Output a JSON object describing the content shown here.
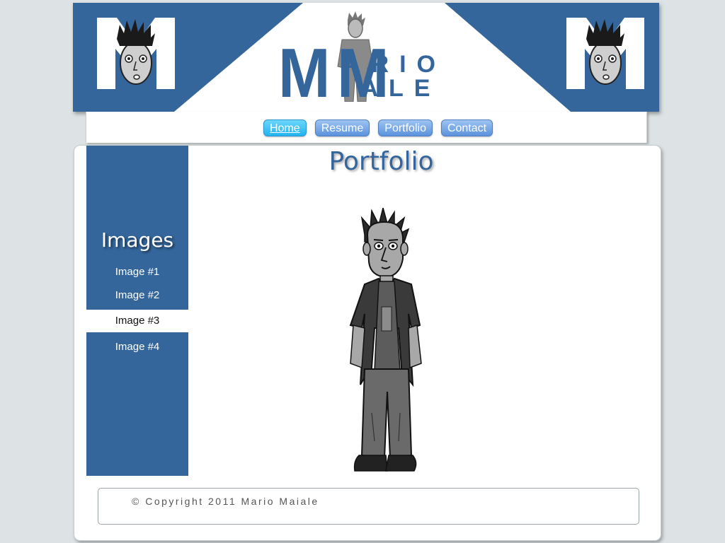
{
  "header": {
    "logo_first": "ARIO",
    "logo_last": "IALE",
    "logo_initial": "M",
    "logo_initial_2": "M"
  },
  "nav": {
    "items": [
      {
        "label": "Home",
        "active": true
      },
      {
        "label": "Resume",
        "active": false
      },
      {
        "label": "Portfolio",
        "active": false
      },
      {
        "label": "Contact",
        "active": false
      }
    ]
  },
  "sidebar": {
    "title": "Images",
    "items": [
      {
        "label": "Image #1",
        "selected": false
      },
      {
        "label": "Image #2",
        "selected": false
      },
      {
        "label": "Image #3",
        "selected": true
      },
      {
        "label": "Image #4",
        "selected": false
      }
    ]
  },
  "main": {
    "title": "Portfolio"
  },
  "footer": {
    "copyright": "© Copyright 2011 Mario Maiale"
  },
  "colors": {
    "brand_blue": "#34669c",
    "nav_button": "#5b92dd",
    "nav_active": "#22b4ee",
    "background": "#dde3e4"
  },
  "icons": {
    "corner_logo": "m-face-logo-icon",
    "main_image": "cartoon-man-illustration"
  }
}
